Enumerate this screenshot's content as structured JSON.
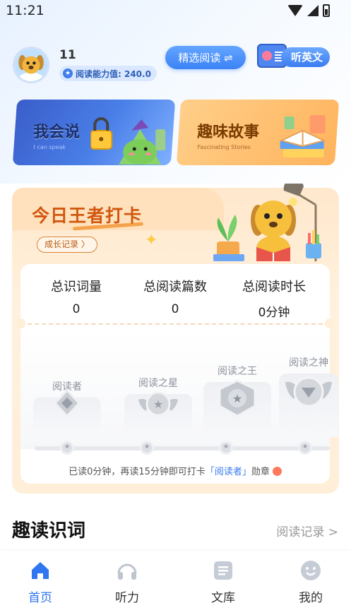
{
  "status_bar": {
    "time": "11:21"
  },
  "header": {
    "username": "11",
    "ability_label": "阅读能力值: 240.0",
    "select_reading": "精选阅读 ⇌",
    "listen_english": "听英文"
  },
  "banners": [
    {
      "title": "我会说",
      "subtitle": "I can speak"
    },
    {
      "title": "趣味故事",
      "subtitle": "Fascinating Stories"
    }
  ],
  "checkin": {
    "title": "今日王者打卡",
    "growth_record": "成长记录 〉",
    "stats": [
      {
        "label": "总识词量",
        "value": "0"
      },
      {
        "label": "总阅读篇数",
        "value": "0"
      },
      {
        "label": "总阅读时长",
        "value": "0分钟"
      }
    ],
    "badges": [
      "阅读者",
      "阅读之星",
      "阅读之王",
      "阅读之神"
    ],
    "tip_prefix": "已读0分钟，再读15分钟即可打卡",
    "tip_highlight": "「阅读者」",
    "tip_suffix": "勋章"
  },
  "section": {
    "title": "趣读识词",
    "link": "阅读记录 >"
  },
  "tabbar": [
    {
      "label": "首页",
      "active": true
    },
    {
      "label": "听力",
      "active": false
    },
    {
      "label": "文库",
      "active": false
    },
    {
      "label": "我的",
      "active": false
    }
  ],
  "colors": {
    "accent": "#2f76f0",
    "checkin_title": "#d1570f"
  }
}
